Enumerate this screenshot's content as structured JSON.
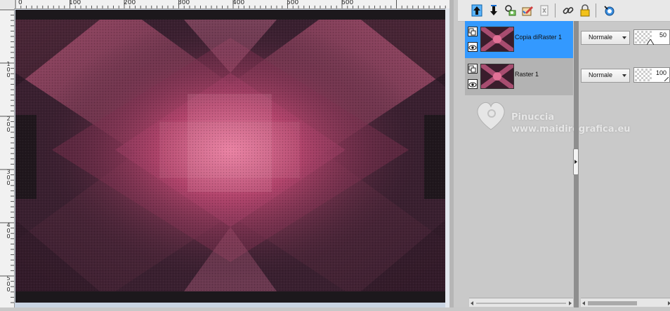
{
  "ruler": {
    "h_labels": [
      "100",
      "200",
      "300",
      "400",
      "500",
      "600"
    ],
    "v_labels": [
      [
        "1",
        "0",
        "0"
      ],
      [
        "2",
        "0",
        "0"
      ],
      [
        "3",
        "0",
        "0"
      ],
      [
        "4",
        "0",
        "0"
      ],
      [
        "5",
        "0",
        "0"
      ]
    ],
    "top_start_digit": "0"
  },
  "toolbar": {
    "icons": [
      "move-layer-up-icon",
      "move-layer-down-icon",
      "new-layer-icon",
      "edit-icon",
      "delete-layer-icon",
      "link-icon",
      "lock-icon",
      "merge-icon"
    ]
  },
  "layers": [
    {
      "name": "Copia diRaster 1",
      "blend_mode": "Normale",
      "opacity": "50",
      "selected": true
    },
    {
      "name": "Raster 1",
      "blend_mode": "Normale",
      "opacity": "100",
      "selected": false
    }
  ],
  "watermark": {
    "name": "Pinuccia",
    "url": "www.maidiregrafica.eu"
  },
  "colors": {
    "selected_row": "#3399ff",
    "unselected_row": "#b3b3b3",
    "canvas_accent": "#d46a8c",
    "canvas_dark": "#2a1e26"
  }
}
